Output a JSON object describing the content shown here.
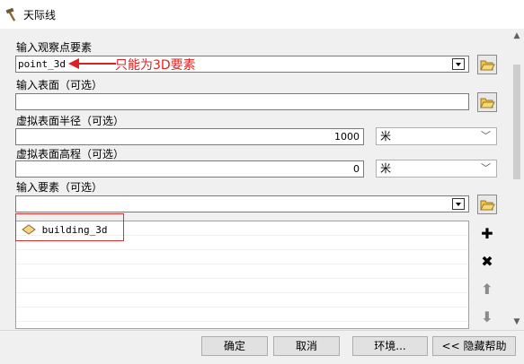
{
  "window": {
    "title": "天际线"
  },
  "form": {
    "observer_label": "输入观察点要素",
    "observer_value": "point_3d",
    "surface_label": "输入表面（可选）",
    "surface_value": "",
    "radius_label": "虚拟表面半径（可选）",
    "radius_value": "1000",
    "radius_unit": "米",
    "elevation_label": "虚拟表面高程（可选）",
    "elevation_value": "0",
    "elevation_unit": "米",
    "features_label": "输入要素（可选）",
    "features_value": "",
    "features_list": [
      "building_3d"
    ]
  },
  "annotation": {
    "text": "只能为3D要素",
    "color": "#e02020"
  },
  "buttons": {
    "ok": "确定",
    "cancel": "取消",
    "env": "环境...",
    "help": "<< 隐藏帮助"
  },
  "icons": {
    "title": "hammer-icon",
    "folder": "open-folder-icon",
    "feature": "polygon-feature-icon",
    "add": "plus-icon",
    "remove": "x-icon",
    "up": "arrow-up-icon",
    "down": "arrow-down-icon"
  }
}
